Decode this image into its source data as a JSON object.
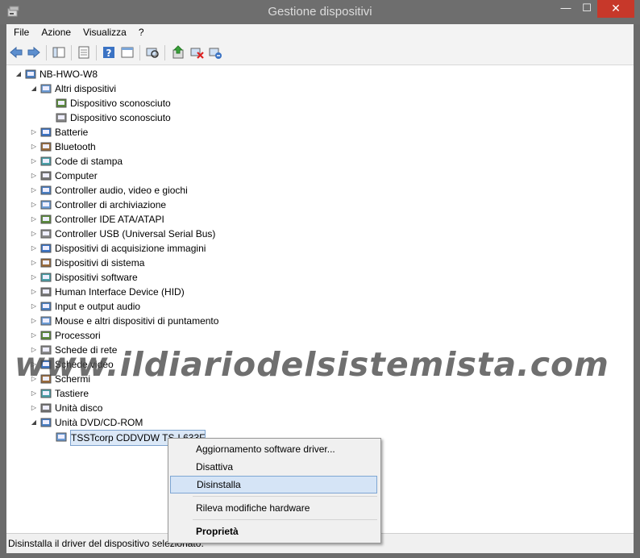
{
  "window": {
    "title": "Gestione dispositivi",
    "min": "—",
    "max": "☐",
    "close": "✕"
  },
  "menu": [
    "File",
    "Azione",
    "Visualizza",
    "?"
  ],
  "tree": {
    "root": "NB-HWO-W8",
    "items": [
      {
        "label": "Altri dispositivi",
        "expanded": true
      },
      {
        "label": "Dispositivo sconosciuto",
        "child": true
      },
      {
        "label": "Dispositivo sconosciuto",
        "child": true
      },
      {
        "label": "Batterie"
      },
      {
        "label": "Bluetooth"
      },
      {
        "label": "Code di stampa"
      },
      {
        "label": "Computer"
      },
      {
        "label": "Controller audio, video e giochi"
      },
      {
        "label": "Controller di archiviazione"
      },
      {
        "label": "Controller IDE ATA/ATAPI"
      },
      {
        "label": "Controller USB (Universal Serial Bus)"
      },
      {
        "label": "Dispositivi di acquisizione immagini"
      },
      {
        "label": "Dispositivi di sistema"
      },
      {
        "label": "Dispositivi software"
      },
      {
        "label": "Human Interface Device (HID)"
      },
      {
        "label": "Input e output audio"
      },
      {
        "label": "Mouse e altri dispositivi di puntamento"
      },
      {
        "label": "Processori"
      },
      {
        "label": "Schede di rete"
      },
      {
        "label": "Schede video"
      },
      {
        "label": "Schermi"
      },
      {
        "label": "Tastiere"
      },
      {
        "label": "Unità disco"
      },
      {
        "label": "Unità DVD/CD-ROM",
        "expanded": true
      },
      {
        "label": "TSSTcorp CDDVDW TS-L633F",
        "child": true,
        "selected": true
      }
    ]
  },
  "context_menu": {
    "update": "Aggiornamento software driver...",
    "disable": "Disattiva",
    "uninstall": "Disinstalla",
    "scan": "Rileva modifiche hardware",
    "properties": "Proprietà"
  },
  "status": "Disinstalla il driver del dispositivo selezionato.",
  "watermark": "www.ildiariodelsistemista.com",
  "colors": {
    "titlebar": "#6e6e6e",
    "close": "#c7382a",
    "selection": "#dbe8f7",
    "highlight": "#d5e4f6"
  }
}
